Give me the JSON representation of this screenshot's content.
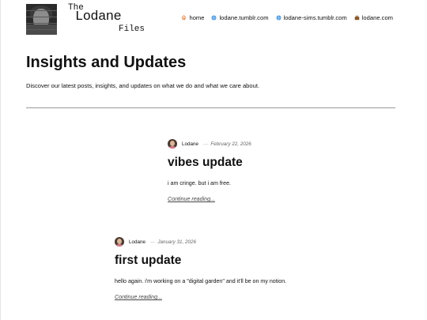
{
  "site": {
    "logo": {
      "line1": "The",
      "line2": "Lodane",
      "line3": "Files"
    },
    "nav": [
      {
        "label": "home",
        "icon": "home-icon"
      },
      {
        "label": "lodane.tumblr.com",
        "icon": "globe-icon"
      },
      {
        "label": "lodane-sims.tumblr.com",
        "icon": "globe-icon"
      },
      {
        "label": "lodane.com",
        "icon": "briefcase-icon"
      }
    ]
  },
  "hero": {
    "title": "Insights and Updates",
    "description": "Discover our latest posts, insights, and updates on what we do and what we care about."
  },
  "posts": [
    {
      "author": "Lodane",
      "date": "February 22, 2026",
      "title": "vibes update",
      "excerpt": "i am cringe. but i am free.",
      "more": "Continue reading..."
    },
    {
      "author": "Lodane",
      "date": "January 31, 2026",
      "title": "first update",
      "excerpt": "hello again. i'm working on a \"digital garden\" and it'll be on my notion.",
      "more": "Continue reading..."
    }
  ],
  "colors": {
    "text": "#111111",
    "divider": "#9a9a9a",
    "nav_globe": "#3b8fd9",
    "nav_home": "#e07b39",
    "nav_briefcase": "#8a5a2b"
  }
}
